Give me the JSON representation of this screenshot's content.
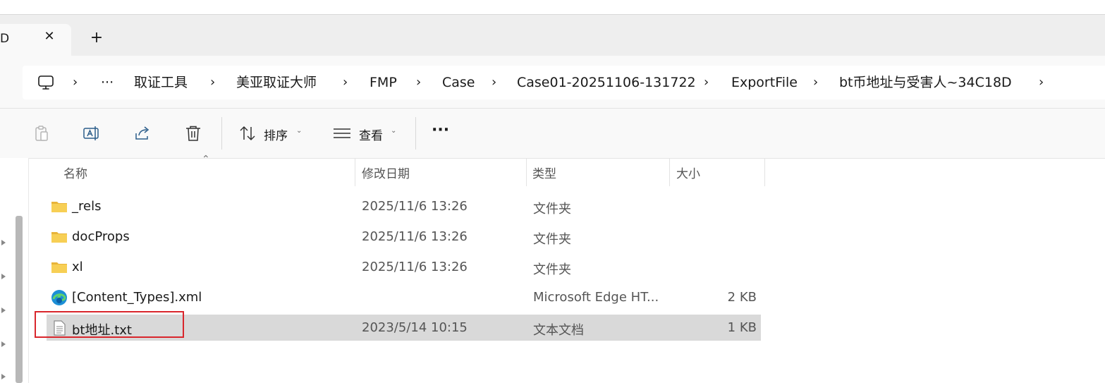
{
  "tab": {
    "title": "D",
    "close_symbol": "✕",
    "new_tab_symbol": "+"
  },
  "breadcrumb": {
    "separator": "›",
    "more": "···",
    "items": [
      "取证工具",
      "美亚取证大师",
      "FMP",
      "Case",
      "Case01-20251106-131722",
      "ExportFile",
      "bt币地址与受害人~34C18D"
    ]
  },
  "toolbar": {
    "sort_label": "排序",
    "view_label": "查看",
    "more_symbol": "···"
  },
  "columns": {
    "name": "名称",
    "date": "修改日期",
    "type": "类型",
    "size": "大小"
  },
  "files": [
    {
      "icon": "folder-icon",
      "name": "_rels",
      "date": "2025/11/6 13:26",
      "type": "文件夹",
      "size": ""
    },
    {
      "icon": "folder-icon",
      "name": "docProps",
      "date": "2025/11/6 13:26",
      "type": "文件夹",
      "size": ""
    },
    {
      "icon": "folder-icon",
      "name": "xl",
      "date": "2025/11/6 13:26",
      "type": "文件夹",
      "size": ""
    },
    {
      "icon": "edge-icon",
      "name": "[Content_Types].xml",
      "date": "",
      "type": "Microsoft Edge HT...",
      "size": "2 KB"
    },
    {
      "icon": "text-file-icon",
      "name": "bt地址.txt",
      "date": "2023/5/14 10:15",
      "type": "文本文档",
      "size": "1 KB",
      "selected": true
    }
  ],
  "colors": {
    "highlight_box": "#d9262c",
    "folder": "#f4c542",
    "selected_row": "#d9d9d9"
  }
}
